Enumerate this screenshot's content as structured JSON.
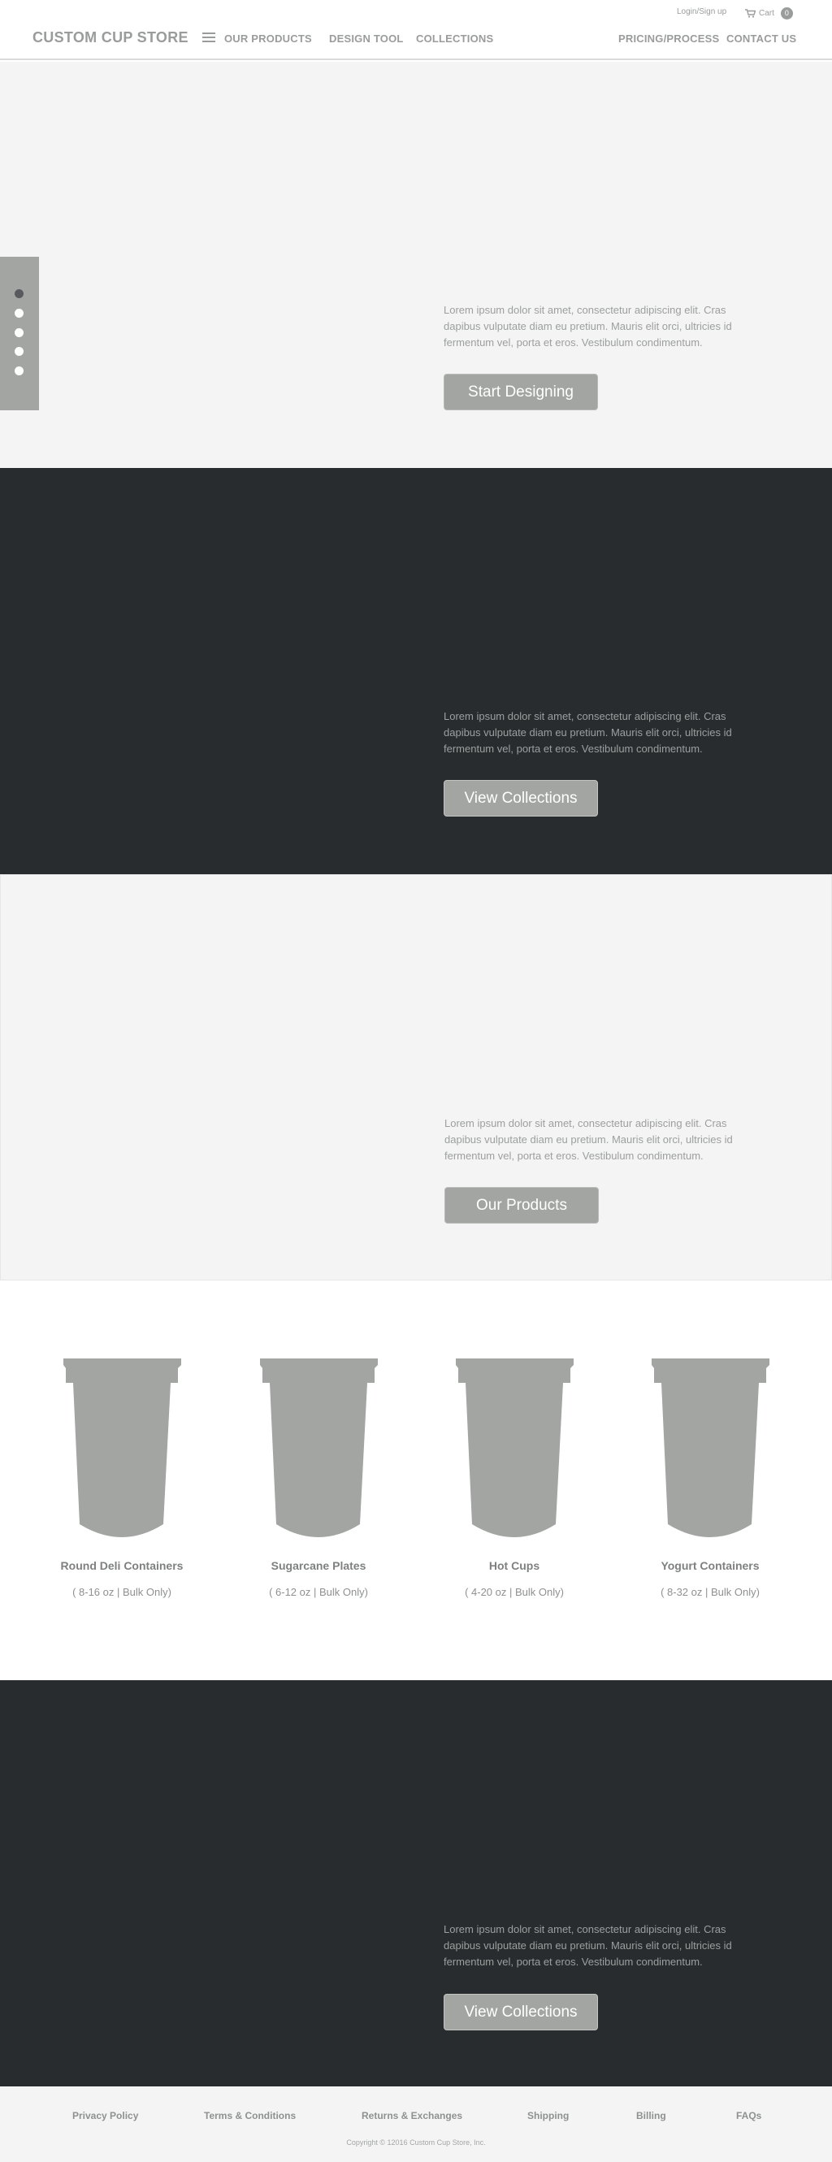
{
  "header": {
    "logo": "CUSTOM CUP STORE",
    "login": "Login/Sign up",
    "cart_label": "Cart",
    "cart_count": "0",
    "nav": {
      "our_products": "OUR PRODUCTS",
      "design_tool": "DESIGN TOOL",
      "collections": "COLLECTIONS",
      "pricing": "PRICING/PROCESS",
      "contact": "CONTACT US"
    }
  },
  "slider": {
    "dot_count": 5,
    "active_index": 0
  },
  "sections": [
    {
      "text": "Lorem ipsum dolor sit amet, consectetur adipiscing elit. Cras dapibus vulputate diam eu pretium. Mauris elit orci, ultricies id fermentum vel, porta et eros. Vestibulum condimentum.",
      "button": "Start Designing"
    },
    {
      "text": "Lorem ipsum dolor sit amet, consectetur adipiscing elit. Cras dapibus vulputate diam eu pretium. Mauris elit orci, ultricies id fermentum vel, porta et eros. Vestibulum condimentum.",
      "button": "View Collections"
    },
    {
      "text": "Lorem ipsum dolor sit amet, consectetur adipiscing elit. Cras dapibus vulputate diam eu pretium. Mauris elit orci, ultricies id fermentum vel, porta et eros. Vestibulum condimentum.",
      "button": "Our Products"
    },
    {
      "text": "Lorem ipsum dolor sit amet, consectetur adipiscing elit. Cras dapibus vulputate diam eu pretium. Mauris elit orci, ultricies id fermentum vel, porta et eros. Vestibulum condimentum.",
      "button": "View Collections"
    }
  ],
  "products": [
    {
      "name": "Round Deli Containers",
      "sub": "( 8-16 oz | Bulk Only)"
    },
    {
      "name": "Sugarcane Plates",
      "sub": "( 6-12 oz | Bulk Only)"
    },
    {
      "name": "Hot Cups",
      "sub": "( 4-20 oz | Bulk Only)"
    },
    {
      "name": "Yogurt Containers",
      "sub": "( 8-32 oz | Bulk Only)"
    }
  ],
  "footer": {
    "links": [
      "Privacy Policy",
      "Terms & Conditions",
      "Returns & Exchanges",
      "Shipping",
      "Billing",
      "FAQs"
    ],
    "copyright": "Copyright © 12016 Custom Cup Store, Inc."
  },
  "colors": {
    "dark_section": "#282c2f",
    "light_section": "#f4f4f4",
    "button": "#a2a5a2",
    "accent_gray": "#9a9c9b"
  }
}
